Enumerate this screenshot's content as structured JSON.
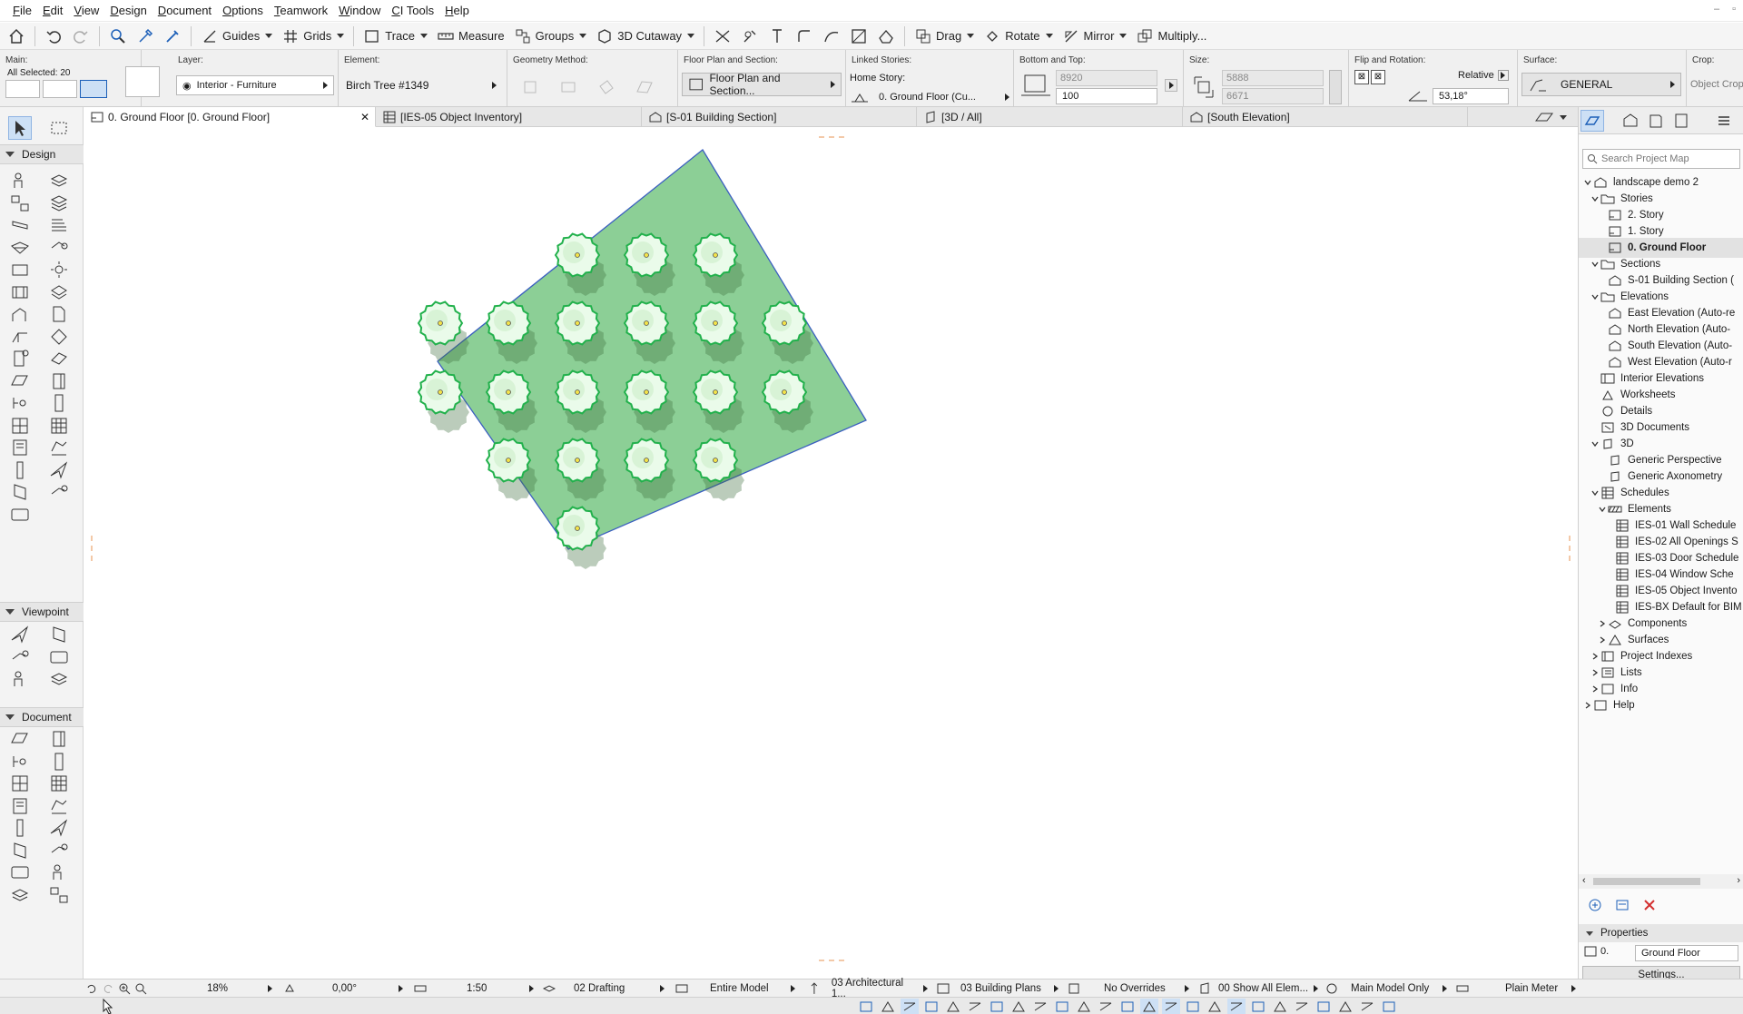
{
  "menu": [
    "File",
    "Edit",
    "View",
    "Design",
    "Document",
    "Options",
    "Teamwork",
    "Window",
    "CI Tools",
    "Help"
  ],
  "toolbar": {
    "guides": "Guides",
    "grids": "Grids",
    "trace": "Trace",
    "measure": "Measure",
    "groups": "Groups",
    "cutaway": "3D Cutaway",
    "drag": "Drag",
    "rotate": "Rotate",
    "mirror": "Mirror",
    "multiply": "Multiply..."
  },
  "infobox": {
    "main_label": "Main:",
    "all_selected": "All Selected: 20",
    "layer_label": "Layer:",
    "layer_value": "Interior - Furniture",
    "element_label": "Element:",
    "element_value": "Birch Tree #1349",
    "geometry_label": "Geometry Method:",
    "floorplan_label": "Floor Plan and Section:",
    "floorplan_value": "Floor Plan and Section...",
    "linked_label": "Linked Stories:",
    "home_story_label": "Home Story:",
    "home_story_value": "0. Ground Floor (Cu...",
    "bottomtop_label": "Bottom and Top:",
    "top_value": "8920",
    "bottom_value": "100",
    "size_label": "Size:",
    "size_a": "5888",
    "size_b": "6671",
    "flip_label": "Flip and Rotation:",
    "relative": "Relative",
    "angle": "53,18°",
    "surface_label": "Surface:",
    "surface_value": "GENERAL",
    "crop_label": "Crop:",
    "crop_value": "Object Crop"
  },
  "tabs": [
    {
      "label": "0. Ground Floor [0. Ground Floor]"
    },
    {
      "label": "[IES-05 Object Inventory]"
    },
    {
      "label": "[S-01 Building Section]"
    },
    {
      "label": "[3D / All]"
    },
    {
      "label": "[South Elevation]"
    }
  ],
  "toolbox": {
    "design": "Design",
    "viewpoint": "Viewpoint",
    "document": "Document"
  },
  "navigator": {
    "search_placeholder": "Search Project Map",
    "tree": [
      {
        "label": "landscape demo 2",
        "caret": "down",
        "icon": "house"
      },
      {
        "label": "Stories",
        "caret": "down",
        "icon": "folder"
      },
      {
        "label": "2. Story",
        "caret": "",
        "icon": "story"
      },
      {
        "label": "1. Story",
        "caret": "",
        "icon": "story"
      },
      {
        "label": "0. Ground Floor",
        "caret": "",
        "icon": "story",
        "selected": true
      },
      {
        "label": "Sections",
        "caret": "down",
        "icon": "folder"
      },
      {
        "label": "S-01 Building Section (",
        "caret": "",
        "icon": "section"
      },
      {
        "label": "Elevations",
        "caret": "down",
        "icon": "folder"
      },
      {
        "label": "East Elevation (Auto-re",
        "caret": "",
        "icon": "elevation"
      },
      {
        "label": "North Elevation (Auto-",
        "caret": "",
        "icon": "elevation"
      },
      {
        "label": "South Elevation (Auto-",
        "caret": "",
        "icon": "elevation"
      },
      {
        "label": "West Elevation (Auto-r",
        "caret": "",
        "icon": "elevation"
      },
      {
        "label": "Interior Elevations",
        "caret": "",
        "icon": "interior"
      },
      {
        "label": "Worksheets",
        "caret": "",
        "icon": "worksheet"
      },
      {
        "label": "Details",
        "caret": "",
        "icon": "detail"
      },
      {
        "label": "3D Documents",
        "caret": "",
        "icon": "doc3d"
      },
      {
        "label": "3D",
        "caret": "down",
        "icon": "cube"
      },
      {
        "label": "Generic Perspective",
        "caret": "",
        "icon": "persp"
      },
      {
        "label": "Generic Axonometry",
        "caret": "",
        "icon": "persp"
      },
      {
        "label": "Schedules",
        "caret": "down",
        "icon": "table"
      },
      {
        "label": "Elements",
        "caret": "down",
        "icon": "elements"
      },
      {
        "label": "IES-01 Wall Schedule",
        "caret": "",
        "icon": "table"
      },
      {
        "label": "IES-02 All Openings S",
        "caret": "",
        "icon": "table"
      },
      {
        "label": "IES-03 Door Schedule",
        "caret": "",
        "icon": "table"
      },
      {
        "label": "IES-04 Window Sche",
        "caret": "",
        "icon": "table"
      },
      {
        "label": "IES-05 Object Invento",
        "caret": "",
        "icon": "table"
      },
      {
        "label": "IES-BX Default for BIM",
        "caret": "",
        "icon": "table"
      },
      {
        "label": "Components",
        "caret": "right",
        "icon": "components"
      },
      {
        "label": "Surfaces",
        "caret": "right",
        "icon": "surfaces"
      },
      {
        "label": "Project Indexes",
        "caret": "right",
        "icon": "index"
      },
      {
        "label": "Lists",
        "caret": "right",
        "icon": "list"
      },
      {
        "label": "Info",
        "caret": "right",
        "icon": "info"
      },
      {
        "label": "Help",
        "caret": "right",
        "icon": "help"
      }
    ],
    "properties_label": "Properties",
    "prop_story_num": "0.",
    "prop_story_name": "Ground Floor",
    "settings_button": "Settings..."
  },
  "statusbar": {
    "zoom": "18%",
    "angle": "0,00°",
    "scale": "1:50",
    "layer_combo": "02 Drafting",
    "model_view": "Entire Model",
    "pen_set": "03 Architectural 1...",
    "view_def": "03 Building Plans",
    "overrides": "No Overrides",
    "renovation": "00 Show All Elem...",
    "structural": "Main Model Only",
    "dimension": "Plain Meter"
  },
  "plan": {
    "fill_color": "#8ccf96",
    "outline_color": "#3b5fc0",
    "tree_color": "#22b14c",
    "tree_rows": [
      3,
      6,
      6,
      4,
      1
    ]
  }
}
